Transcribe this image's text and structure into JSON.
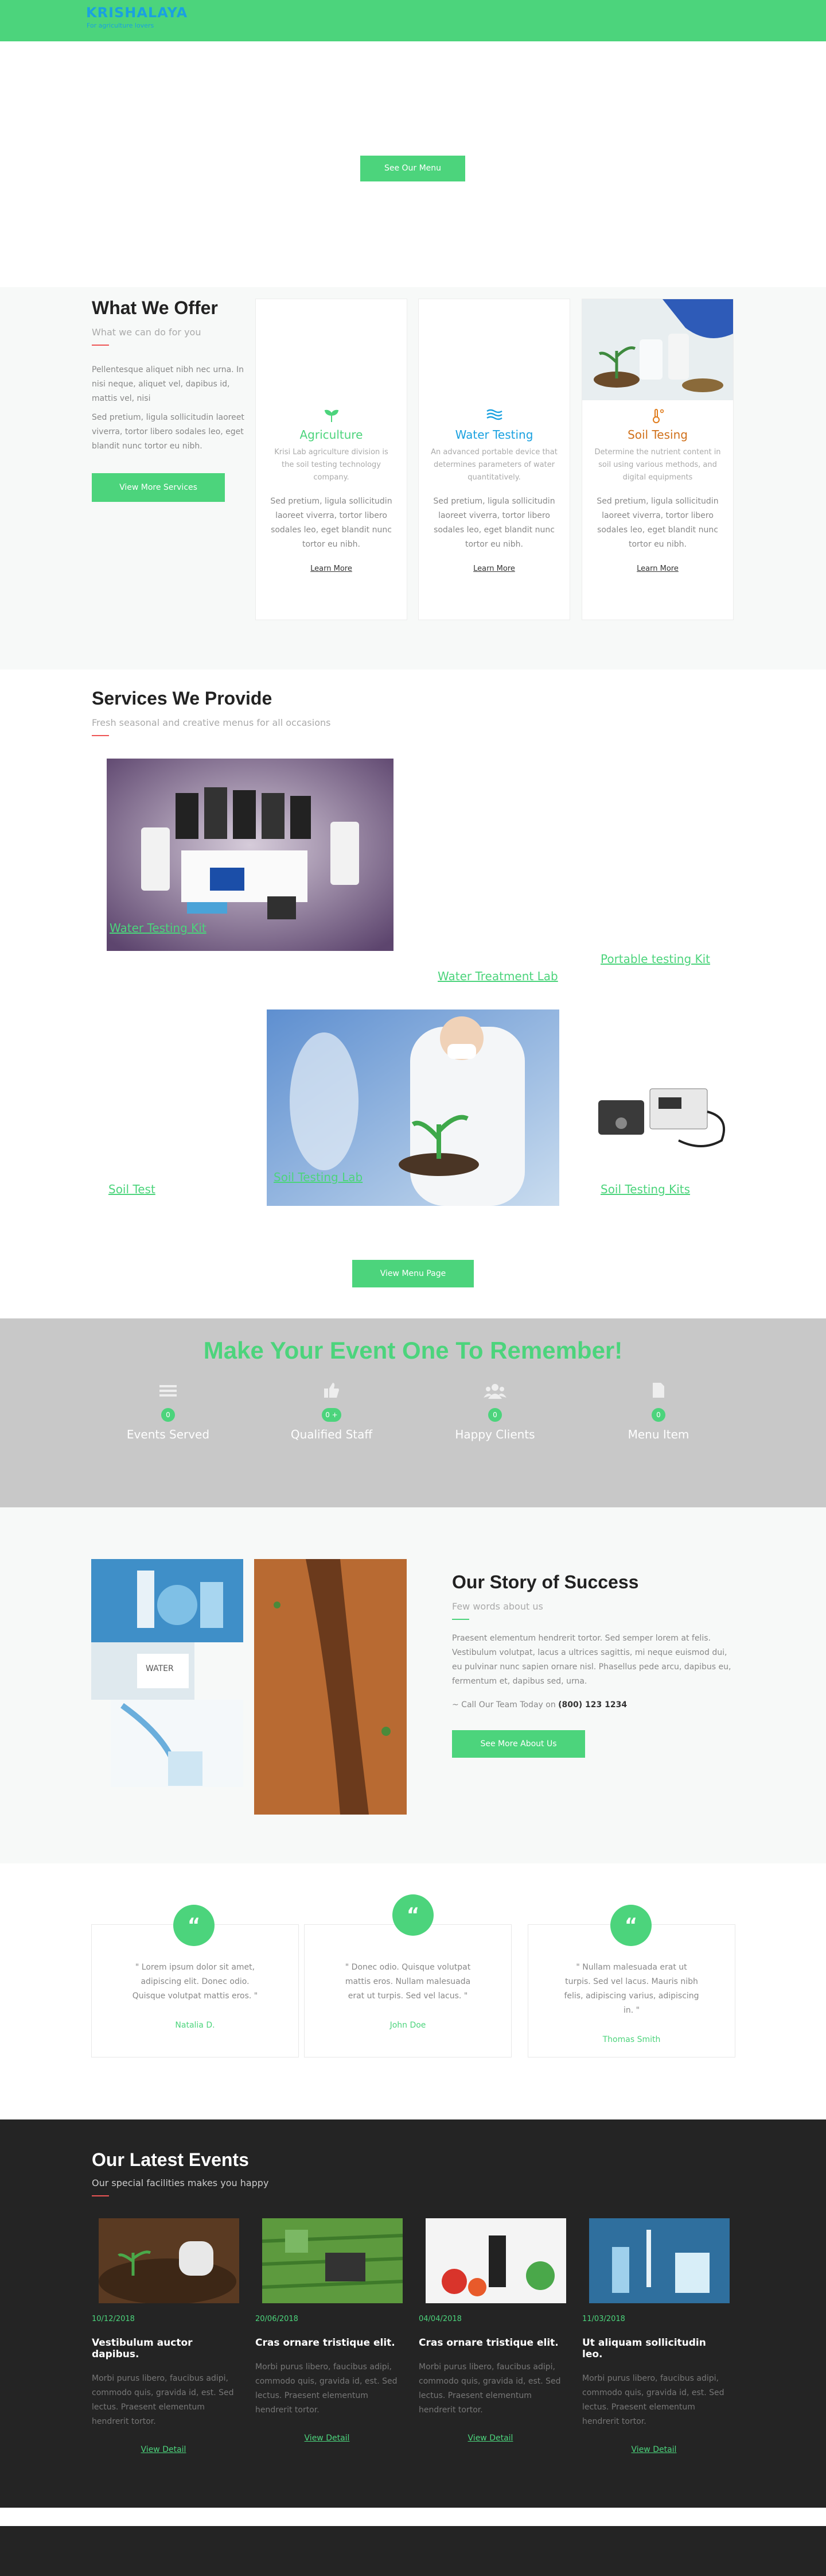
{
  "header": {
    "logo": "KRISHALAYA",
    "tagline": "For agriculture lovers"
  },
  "hero": {
    "button": "See Our Menu"
  },
  "offer": {
    "title": "What We Offer",
    "subtitle": "What we can do for you",
    "p1": "Pellentesque aliquet nibh nec urna. In nisi neque, aliquet vel, dapibus id, mattis vel, nisi",
    "p2": "Sed pretium, ligula sollicitudin laoreet viverra, tortor libero sodales leo, eget blandit nunc tortor eu nibh.",
    "button": "View More Services",
    "cards": [
      {
        "title": "Agriculture",
        "lead": "Krisi Lab agriculture division is the soil testing technology company.",
        "body": "Sed pretium, ligula sollicitudin laoreet viverra, tortor libero sodales leo, eget blandit nunc tortor eu nibh.",
        "link": "Learn More"
      },
      {
        "title": "Water Testing",
        "lead": "An advanced portable device that determines parameters of water quantitatively.",
        "body": "Sed pretium, ligula sollicitudin laoreet viverra, tortor libero sodales leo, eget blandit nunc tortor eu nibh.",
        "link": "Learn More"
      },
      {
        "title": "Soil Tesing",
        "lead": "Determine the nutrient content in soil using various methods, and digital equipments",
        "body": "Sed pretium, ligula sollicitudin laoreet viverra, tortor libero sodales leo, eget blandit nunc tortor eu nibh.",
        "link": "Learn More"
      }
    ]
  },
  "services": {
    "title": "Services We Provide",
    "subtitle": "Fresh seasonal and creative menus for all occasions",
    "items": [
      "Water Testing Kit",
      "Water Treatment Lab",
      "Portable testing Kit",
      "Soil Test",
      "Soil Testing Lab",
      "Soil Testing Kits"
    ],
    "button": "View Menu Page"
  },
  "event": {
    "title": "Make Your Event One To Remember!",
    "stats": [
      {
        "value": "0",
        "label": "Events Served"
      },
      {
        "value": "0 +",
        "label": "Qualified Staff"
      },
      {
        "value": "0",
        "label": "Happy Clients"
      },
      {
        "value": "0",
        "label": "Menu Item"
      }
    ]
  },
  "story": {
    "title": "Our Story of Success",
    "subtitle": "Few words about us",
    "body": "Praesent elementum hendrerit tortor. Sed semper lorem at felis. Vestibulum volutpat, lacus a ultrices sagittis, mi neque euismod dui, eu pulvinar nunc sapien ornare nisl. Phasellus pede arcu, dapibus eu, fermentum et, dapibus sed, urna.",
    "call_prefix": "~ Call Our Team Today on",
    "phone": "(800) 123 1234",
    "button": "See More About Us"
  },
  "testimonials": [
    {
      "text": "\" Lorem ipsum dolor sit amet, adipiscing elit. Donec odio. Quisque volutpat mattis eros. \"",
      "name": "Natalia D."
    },
    {
      "text": "\" Donec odio. Quisque volutpat mattis eros. Nullam malesuada erat ut turpis. Sed vel lacus. \"",
      "name": "John Doe"
    },
    {
      "text": "\" Nullam malesuada erat ut turpis. Sed vel lacus. Mauris nibh felis, adipiscing varius, adipiscing in. \"",
      "name": "Thomas Smith"
    }
  ],
  "events": {
    "title": "Our Latest Events",
    "subtitle": "Our special facilities makes you happy",
    "items": [
      {
        "date": "10/12/2018",
        "title": "Vestibulum auctor dapibus.",
        "body": "Morbi purus libero, faucibus adipi, commodo quis, gravida id, est. Sed lectus. Praesent elementum hendrerit tortor.",
        "link": "View Detail"
      },
      {
        "date": "20/06/2018",
        "title": "Cras ornare tristique elit.",
        "body": "Morbi purus libero, faucibus adipi, commodo quis, gravida id, est. Sed lectus. Praesent elementum hendrerit tortor.",
        "link": "View Detail"
      },
      {
        "date": "04/04/2018",
        "title": "Cras ornare tristique elit.",
        "body": "Morbi purus libero, faucibus adipi, commodo quis, gravida id, est. Sed lectus. Praesent elementum hendrerit tortor.",
        "link": "View Detail"
      },
      {
        "date": "11/03/2018",
        "title": "Ut aliquam sollicitudin leo.",
        "body": "Morbi purus libero, faucibus adipi, commodo quis, gravida id, est. Sed lectus. Praesent elementum hendrerit tortor.",
        "link": "View Detail"
      }
    ]
  },
  "colors": {
    "accent": "#4cd47c",
    "logo": "#1aa1e0",
    "dark": "#242424",
    "grey_band": "#c8c8c8"
  }
}
